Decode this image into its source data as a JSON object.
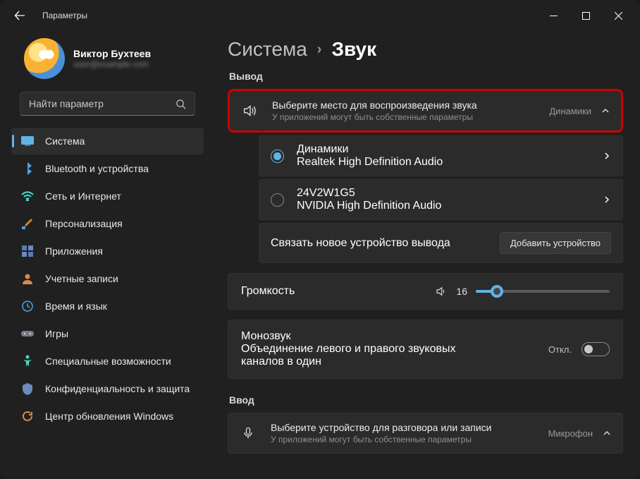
{
  "window": {
    "title": "Параметры"
  },
  "profile": {
    "name": "Виктор Бухтеев",
    "sub": "user@example.com"
  },
  "search": {
    "placeholder": "Найти параметр"
  },
  "nav": [
    {
      "label": "Система",
      "icon": "system",
      "selected": true
    },
    {
      "label": "Bluetooth и устройства",
      "icon": "bluetooth"
    },
    {
      "label": "Сеть и Интернет",
      "icon": "wifi"
    },
    {
      "label": "Персонализация",
      "icon": "brush"
    },
    {
      "label": "Приложения",
      "icon": "apps"
    },
    {
      "label": "Учетные записи",
      "icon": "account"
    },
    {
      "label": "Время и язык",
      "icon": "time"
    },
    {
      "label": "Игры",
      "icon": "games"
    },
    {
      "label": "Специальные возможности",
      "icon": "accessibility"
    },
    {
      "label": "Конфиденциальность и защита",
      "icon": "privacy"
    },
    {
      "label": "Центр обновления Windows",
      "icon": "update"
    }
  ],
  "breadcrumb": {
    "parent": "Система",
    "current": "Звук"
  },
  "output": {
    "heading": "Вывод",
    "picker": {
      "title": "Выберите место для воспроизведения звука",
      "subtitle": "У приложений могут быть собственные параметры",
      "value": "Динамики"
    },
    "devices": [
      {
        "name": "Динамики",
        "detail": "Realtek High Definition Audio",
        "selected": true
      },
      {
        "name": "24V2W1G5",
        "detail": "NVIDIA High Definition Audio",
        "selected": false
      }
    ],
    "pair": {
      "text": "Связать новое устройство вывода",
      "button": "Добавить устройство"
    },
    "volume": {
      "label": "Громкость",
      "value": "16",
      "percent": 16
    },
    "mono": {
      "title": "Монозвук",
      "subtitle": "Объединение левого и правого звуковых каналов в один",
      "state": "Откл."
    }
  },
  "input": {
    "heading": "Ввод",
    "picker": {
      "title": "Выберите устройство для разговора или записи",
      "subtitle": "У приложений могут быть собственные параметры",
      "value": "Микрофон"
    }
  }
}
